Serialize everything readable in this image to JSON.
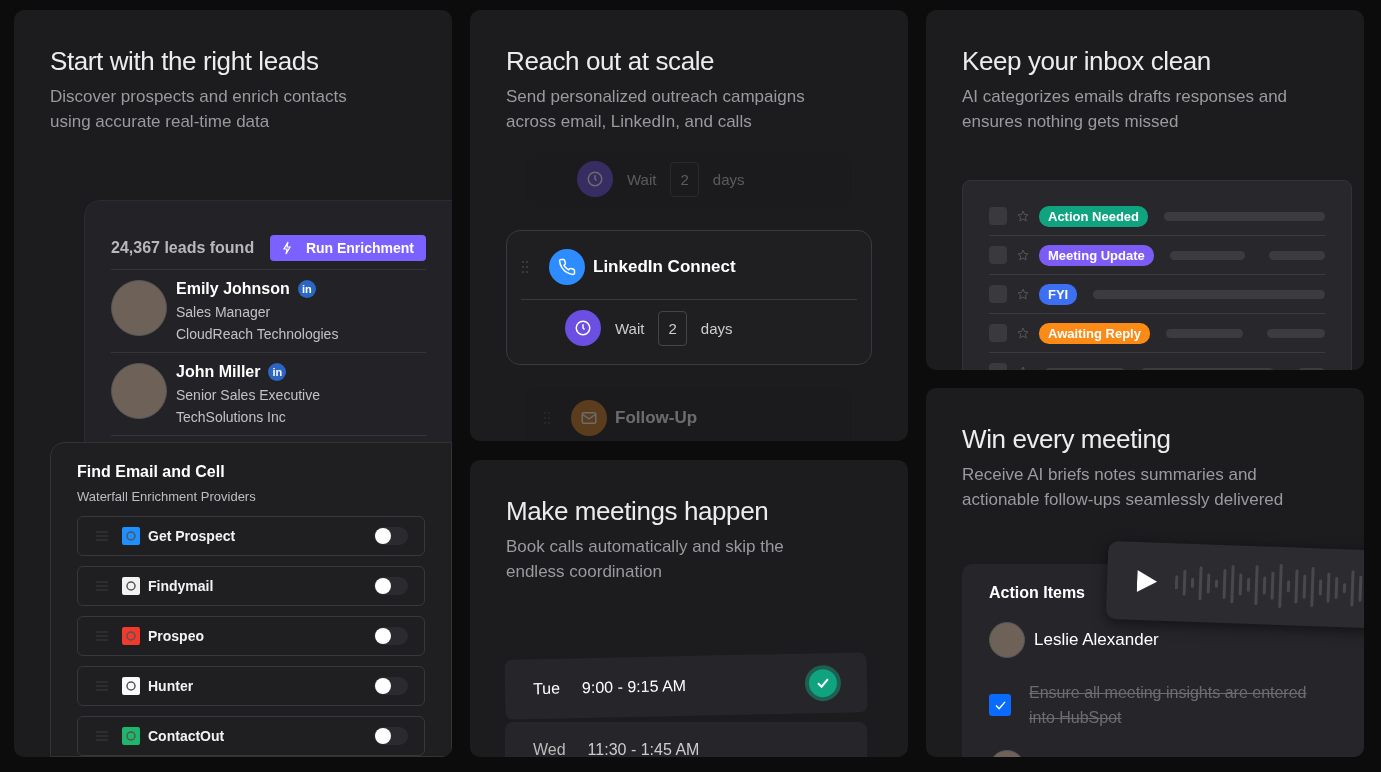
{
  "leads_card": {
    "title": "Start with the right leads",
    "subtitle": "Discover prospects and enrich contacts using accurate real-time data",
    "count": "24,367 leads found",
    "button": "Run Enrichment",
    "leads": [
      {
        "name": "Emily Johnson",
        "badge": "in",
        "role": "Sales Manager",
        "company": "CloudReach Technologies"
      },
      {
        "name": "John Miller",
        "badge": "in",
        "role": "Senior Sales Executive",
        "company": "TechSolutions Inc"
      }
    ],
    "providers_panel": {
      "title": "Find Email and Cell",
      "subtitle": "Waterfall Enrichment Providers",
      "providers": [
        {
          "name": "Get Prospect",
          "color": "#1e90ff",
          "on": false
        },
        {
          "name": "Findymail",
          "color": "#f2f2f2",
          "on": false
        },
        {
          "name": "Prospeo",
          "color": "#f03a2e",
          "on": false
        },
        {
          "name": "Hunter",
          "color": "#fafafa",
          "on": false
        },
        {
          "name": "ContactOut",
          "color": "#1fb56b",
          "on": false
        }
      ]
    }
  },
  "outreach_card": {
    "title": "Reach out at scale",
    "subtitle": "Send personalized outreach campaigns across email, LinkedIn, and calls",
    "steps": [
      {
        "kind": "wait",
        "active": false,
        "wait": {
          "text": "Wait",
          "count": "2",
          "unit": "days"
        }
      },
      {
        "kind": "call",
        "active": true,
        "title": "LinkedIn Connect",
        "wait": {
          "text": "Wait",
          "count": "2",
          "unit": "days"
        }
      },
      {
        "kind": "email",
        "active": false,
        "title": "Follow-Up"
      }
    ]
  },
  "inbox_card": {
    "title": "Keep your inbox clean",
    "subtitle": "AI categorizes emails drafts responses and ensures nothing gets missed",
    "rows": [
      {
        "tag": "Action Needed",
        "color": "#10a37f",
        "checked": false
      },
      {
        "tag": "Meeting Update",
        "color": "#7c5cf5",
        "checked": false
      },
      {
        "tag": "FYI",
        "color": "#3d6ff2",
        "checked": false
      },
      {
        "tag": "Awaiting Reply",
        "color": "#fb8a16",
        "checked": false
      },
      {
        "checked": false
      }
    ]
  },
  "meetings_card": {
    "title": "Make meetings happen",
    "subtitle": "Book calls automatically and skip the endless coordination",
    "slots": [
      {
        "day": "Tue",
        "time": "9:00 - 9:15 AM",
        "selected": true
      },
      {
        "day": "Wed",
        "time": "11:30 - 1:45 AM",
        "selected": false
      }
    ]
  },
  "briefs_card": {
    "title": "Win every meeting",
    "subtitle": "Receive AI briefs notes summaries and actionable follow-ups seamlessly delivered",
    "panel_title": "Action Items",
    "person": "Leslie Alexander",
    "task": {
      "text": "Ensure all meeting insights are entered into HubSpot",
      "checked": true
    }
  }
}
